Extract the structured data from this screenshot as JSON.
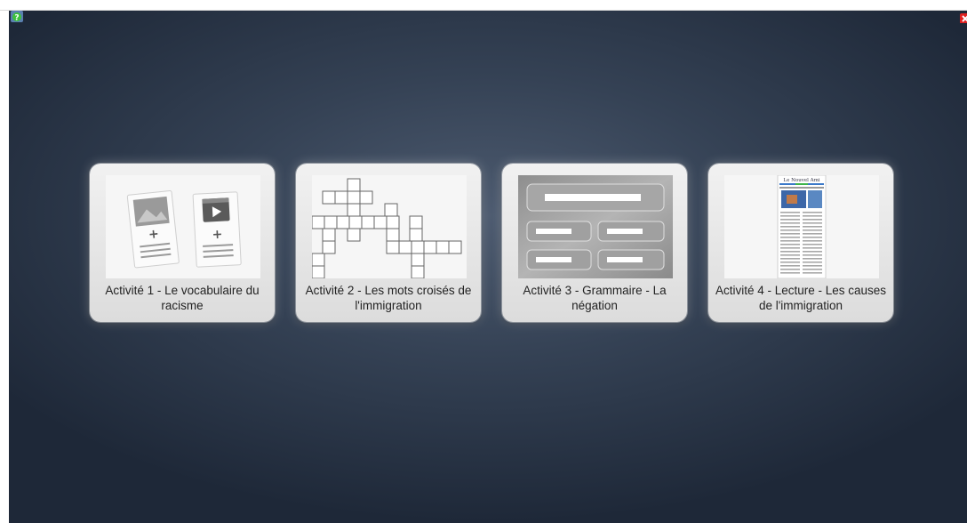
{
  "activities": [
    {
      "title": "Activité 1 - Le vocabulaire du racisme",
      "thumb_icon": "media-cards-icon"
    },
    {
      "title": "Activité 2 - Les mots croisés de l'immigration",
      "thumb_icon": "crossword-icon"
    },
    {
      "title": "Activité 3 - Grammaire - La négation",
      "thumb_icon": "button-grid-icon"
    },
    {
      "title": "Activité 4 - Lecture - Les causes de l'immigration",
      "thumb_icon": "newspaper-icon"
    }
  ],
  "newspaper_masthead": "Le Nouvel Ami",
  "toolbar": {
    "help_icon": "help-icon",
    "close_icon": "close-icon"
  },
  "colors": {
    "stage_center": "#4d5b70",
    "stage_edge": "#1e2838",
    "tile": "#e6e6e6",
    "help_green": "#35b535",
    "close_red": "#e02020"
  }
}
